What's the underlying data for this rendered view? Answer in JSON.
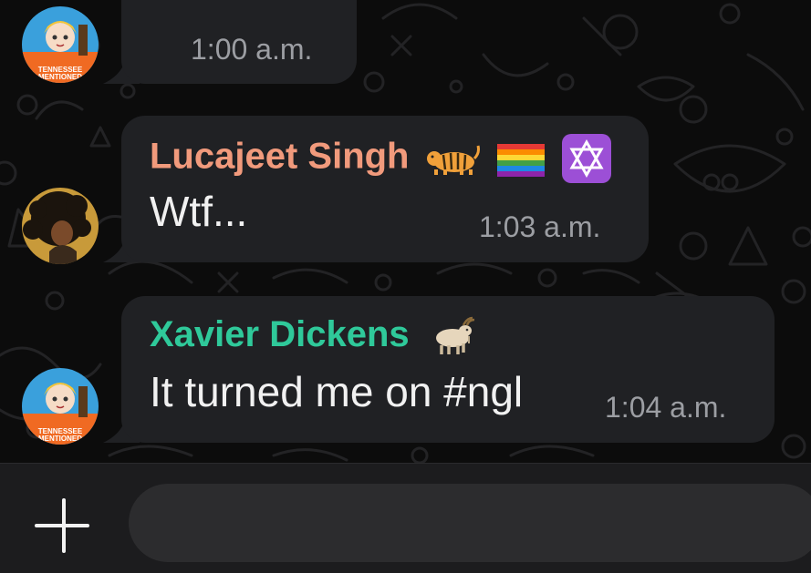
{
  "messages": [
    {
      "sender": "",
      "text": "",
      "time": "1:00 a.m."
    },
    {
      "sender": "Lucajeet Singh",
      "sender_color": "#f19a7c",
      "sender_icons": [
        "tiger-emoji",
        "rainbow-flag-emoji",
        "star-of-david-emoji"
      ],
      "text": "Wtf...",
      "time": "1:03 a.m."
    },
    {
      "sender": "Xavier Dickens",
      "sender_color": "#2fc99a",
      "sender_icons": [
        "goat-emoji"
      ],
      "text": "It turned me on #ngl",
      "time": "1:04 a.m."
    }
  ],
  "avatars": [
    {
      "icon": "anime-character-avatar",
      "caption": "TENNESSEE MENTIONED"
    },
    {
      "icon": "curly-hair-person-avatar"
    },
    {
      "icon": "anime-character-avatar",
      "caption": "TENNESSEE MENTIONED"
    }
  ],
  "composer": {
    "placeholder": "",
    "add_icon": "plus-icon"
  },
  "colors": {
    "bubble": "#202124",
    "background": "#0c0c0c",
    "time": "#9c9ea3"
  }
}
